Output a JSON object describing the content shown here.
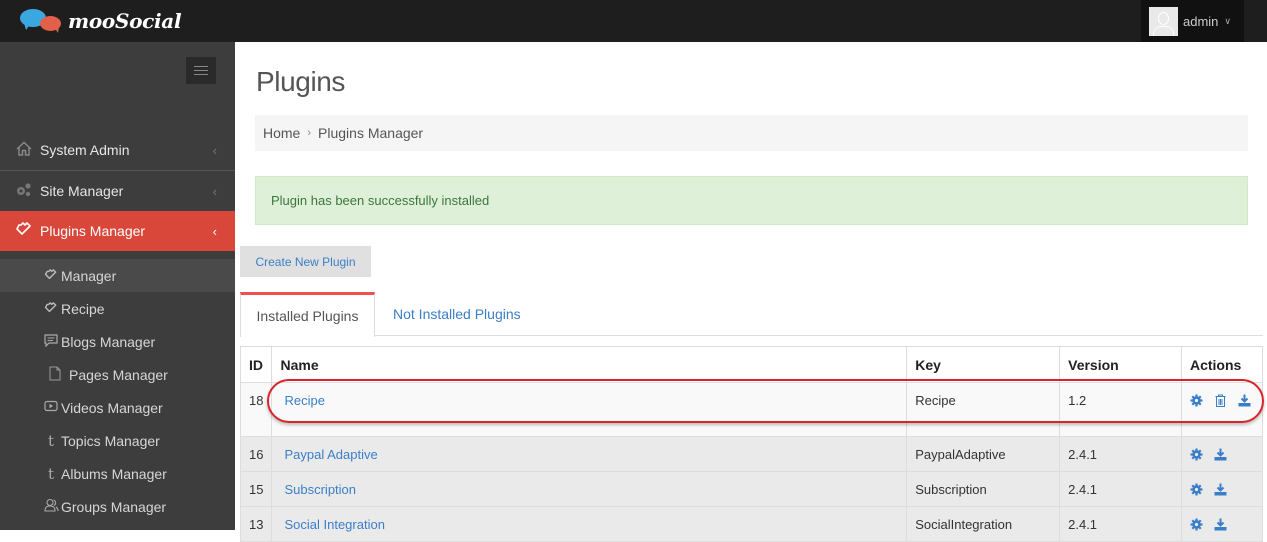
{
  "app": {
    "brand": "mooSocial",
    "user": {
      "name": "admin",
      "avatar_icon": "user-silhouette-icon",
      "caret_icon": "chevron-down-icon"
    }
  },
  "sidebar": {
    "toggle_icon": "hamburger-icon",
    "items": [
      {
        "label": "System Admin",
        "icon": "home-icon",
        "chevron": "‹",
        "active": false
      },
      {
        "label": "Site Manager",
        "icon": "gears-icon",
        "chevron": "‹",
        "active": false
      },
      {
        "label": "Plugins Manager",
        "icon": "puzzle-icon",
        "chevron": "‹",
        "active": true
      }
    ],
    "subitems": [
      {
        "label": "Manager",
        "icon": "puzzle-icon",
        "current": true
      },
      {
        "label": "Recipe",
        "icon": "puzzle-icon",
        "current": false
      },
      {
        "label": "Blogs Manager",
        "icon": "comment-icon",
        "current": false
      },
      {
        "label": "Pages Manager",
        "icon": "page-icon",
        "current": false
      },
      {
        "label": "Videos Manager",
        "icon": "video-icon",
        "current": false
      },
      {
        "label": "Topics Manager",
        "icon": "tumblr-icon",
        "current": false
      },
      {
        "label": "Albums Manager",
        "icon": "tumblr-icon",
        "current": false
      },
      {
        "label": "Groups Manager",
        "icon": "group-icon",
        "current": false
      }
    ]
  },
  "main": {
    "title": "Plugins",
    "breadcrumb": {
      "home": "Home",
      "separator": "›",
      "current": "Plugins Manager"
    },
    "alert": "Plugin has been successfully installed",
    "create_button": "Create New Plugin",
    "tabs": [
      {
        "label": "Installed Plugins",
        "active": true
      },
      {
        "label": "Not Installed Plugins",
        "active": false
      }
    ],
    "table": {
      "headers": [
        "ID",
        "Name",
        "Key",
        "Version",
        "Actions"
      ],
      "rows": [
        {
          "id": "18",
          "name": "Recipe",
          "key": "Recipe",
          "version": "1.2",
          "actions": [
            "settings",
            "delete",
            "download"
          ],
          "highlighted": true
        },
        {
          "id": "16",
          "name": "Paypal Adaptive",
          "key": "PaypalAdaptive",
          "version": "2.4.1",
          "actions": [
            "settings",
            "download"
          ],
          "highlighted": false
        },
        {
          "id": "15",
          "name": "Subscription",
          "key": "Subscription",
          "version": "2.4.1",
          "actions": [
            "settings",
            "download"
          ],
          "highlighted": false
        },
        {
          "id": "13",
          "name": "Social Integration",
          "key": "SocialIntegration",
          "version": "2.4.1",
          "actions": [
            "settings",
            "download"
          ],
          "highlighted": false
        }
      ]
    }
  },
  "colors": {
    "accent": "#d9463a",
    "link": "#3b7ec8",
    "alert_bg": "#dff0d8",
    "alert_text": "#3c763d",
    "tab_active_border": "#f05050",
    "highlight_oval": "#d9222a"
  }
}
